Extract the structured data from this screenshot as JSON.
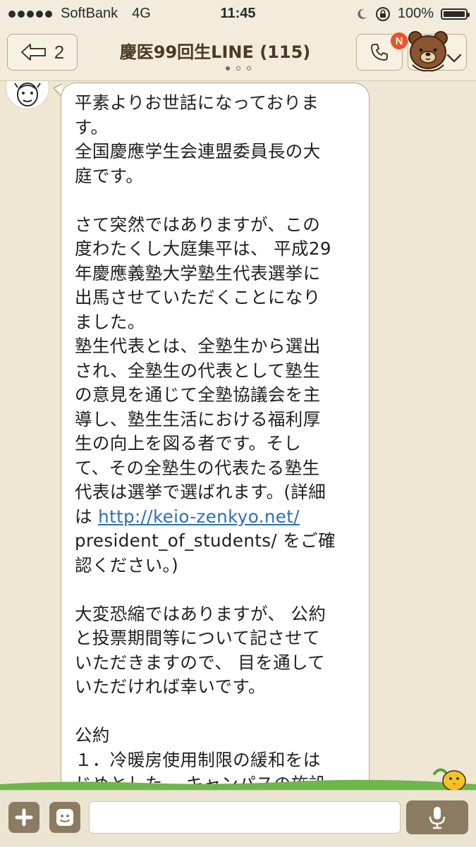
{
  "status_bar": {
    "carrier": "SoftBank",
    "network": "4G",
    "time": "11:45",
    "battery": "100%",
    "icons": [
      "signal-dots-icon",
      "moon-icon",
      "orientation-lock-icon",
      "battery-icon"
    ]
  },
  "header": {
    "back_count": "2",
    "title": "慶医99回生LINE (115)",
    "notification_badge": "N",
    "icons": [
      "back-arrow-icon",
      "phone-icon",
      "brown-bear-icon",
      "chevron-down-icon"
    ]
  },
  "message": {
    "lines": [
      "平素よりお世話になっておりま",
      "す。",
      "全国慶應学生会連盟委員長の大",
      "庭です。",
      "",
      "さて突然ではありますが、この",
      "度わたくし大庭集平は、 平成29",
      "年慶應義塾大学塾生代表選挙に",
      "出馬させていただくことになり",
      "ました。",
      "塾生代表とは、全塾生から選出",
      "され、全塾生の代表として塾生",
      "の意見を通じて全塾協議会を主",
      "導し、塾生生活における福利厚",
      "生の向上を図る者です。そし",
      "て、その全塾生の代表たる塾生",
      "代表は選挙で選ばれます。(詳細"
    ],
    "link_prefix": "は ",
    "link_text": "http://keio-zenkyo.net/",
    "lines_after_link": [
      "president_of_students/ をご確",
      "認ください。)",
      "",
      "大変恐縮ではありますが、 公約",
      "と投票期間等について記させて",
      "いただきますので、 目を通して",
      "いただければ幸いです。",
      "",
      "公約",
      "１．冷暖房使用制限の緩和をは",
      "じめとした、 キャンパスの施設"
    ]
  },
  "input_bar": {
    "placeholder": "",
    "icons": [
      "plus-icon",
      "sticker-icon",
      "microphone-icon"
    ]
  },
  "colors": {
    "background": "#efe7d4",
    "header": "#f3ecdc",
    "bubble_border": "#b6a888",
    "link": "#2a6fb8",
    "badge": "#e8532a",
    "input_button": "#8a7b62"
  }
}
